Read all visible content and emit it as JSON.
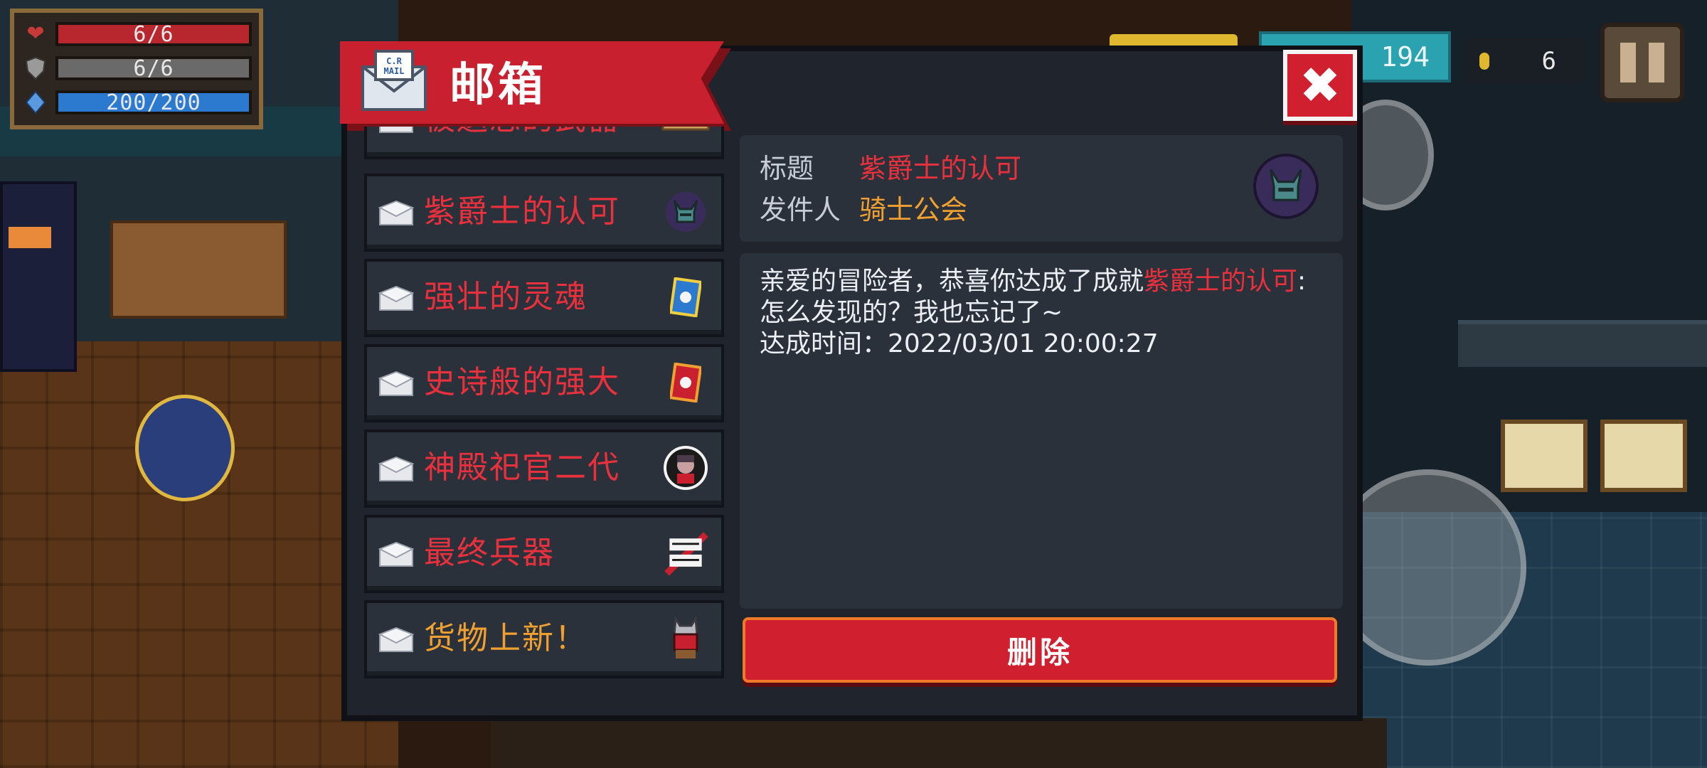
{
  "hud": {
    "health": "6/6",
    "armor": "6/6",
    "energy": "200/200",
    "gems": "194",
    "coins": "6",
    "colors": {
      "health": "#b8262e",
      "armor": "#6a6a6a",
      "energy": "#2c7ad0"
    }
  },
  "mailbox": {
    "title": "邮箱",
    "icon_text": "C.R MAIL",
    "items": [
      {
        "label": "被遗忘的武器",
        "thumb": "scroll-map-icon",
        "color": "red"
      },
      {
        "label": "紫爵士的认可",
        "thumb": "horned-knight-icon",
        "color": "red"
      },
      {
        "label": "强壮的灵魂",
        "thumb": "blue-card-icon",
        "color": "red"
      },
      {
        "label": "史诗般的强大",
        "thumb": "red-card-icon",
        "color": "red"
      },
      {
        "label": "神殿祀官二代",
        "thumb": "priest-portrait-icon",
        "color": "red"
      },
      {
        "label": "最终兵器",
        "thumb": "final-weapon-logo",
        "color": "red"
      },
      {
        "label": "货物上新！",
        "thumb": "merchant-cat-icon",
        "color": "orange"
      }
    ],
    "detail": {
      "title_key": "标题",
      "title_value": "紫爵士的认可",
      "sender_key": "发件人",
      "sender_value": "骑士公会",
      "body_prefix": "亲爱的冒险者，恭喜你达成了成就",
      "body_highlight": "紫爵士的认可",
      "body_suffix": ":怎么发现的？我也忘记了~",
      "time_line": "达成时间：2022/03/01 20:00:27"
    },
    "delete_label": "删除"
  }
}
